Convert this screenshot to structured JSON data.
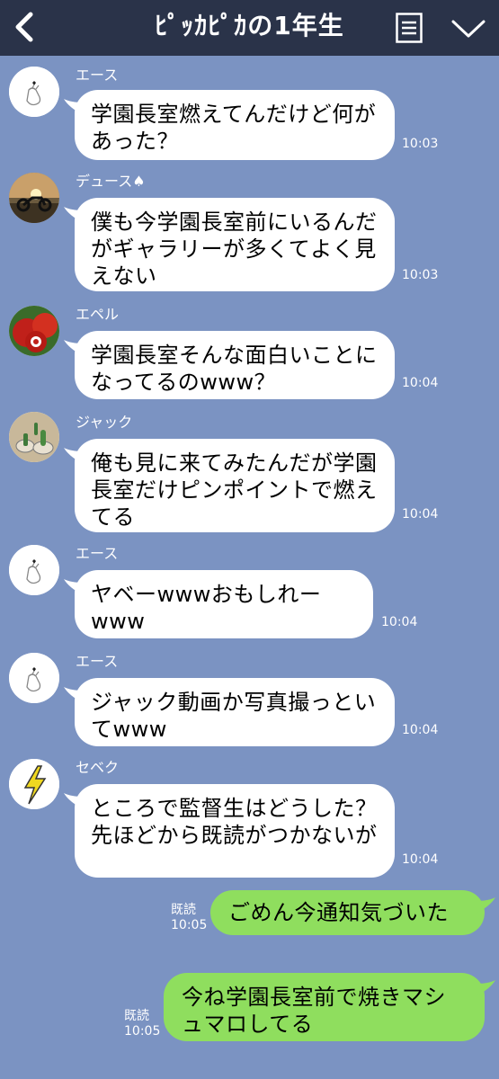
{
  "header": {
    "title": "ﾋﾟｯｶﾋﾟｶの1年生",
    "back_icon": "chevron-left-icon",
    "menu_icon": "menu-icon",
    "collapse_icon": "chevron-down-icon"
  },
  "messages": [
    {
      "sender": "エース",
      "text": "学園長室燃えてんだけど何があった？",
      "time": "10:03",
      "avatar_icon": "hand-heart-icon"
    },
    {
      "sender": "デュース♠",
      "text": "僕も今学園長室前にいるんだがギャラリーが多くてよく見えない",
      "time": "10:03",
      "avatar_icon": "motorcycle-sunset-icon"
    },
    {
      "sender": "エペル",
      "text": "学園長室そんな面白いことになってるのwww？",
      "time": "10:04",
      "avatar_icon": "apple-icon"
    },
    {
      "sender": "ジャック",
      "text": "俺も見に来てみたんだが学園長室だけピンポイントで燃えてる",
      "time": "10:04",
      "avatar_icon": "cactus-icon"
    },
    {
      "sender": "エース",
      "text": "ヤベーwwwおもしれーwww",
      "time": "10:04",
      "avatar_icon": "hand-heart-icon"
    },
    {
      "sender": "エース",
      "text": "ジャック動画か写真撮っといてwww",
      "time": "10:04",
      "avatar_icon": "hand-heart-icon"
    },
    {
      "sender": "セベク",
      "text": "ところで監督生はどうした？先ほどから既読がつかないが",
      "time": "10:04",
      "avatar_icon": "lightning-icon"
    }
  ],
  "my_messages": [
    {
      "text": "ごめん今通知気づいた",
      "read_label": "既読",
      "time": "10:05"
    },
    {
      "text": "今ね学園長室前で焼きマシュマロしてる",
      "read_label": "既読",
      "time": "10:05"
    }
  ],
  "colors": {
    "header_bg": "#2a3349",
    "chat_bg": "#7b93c2",
    "my_bubble": "#8fde5e",
    "other_bubble": "#ffffff"
  }
}
